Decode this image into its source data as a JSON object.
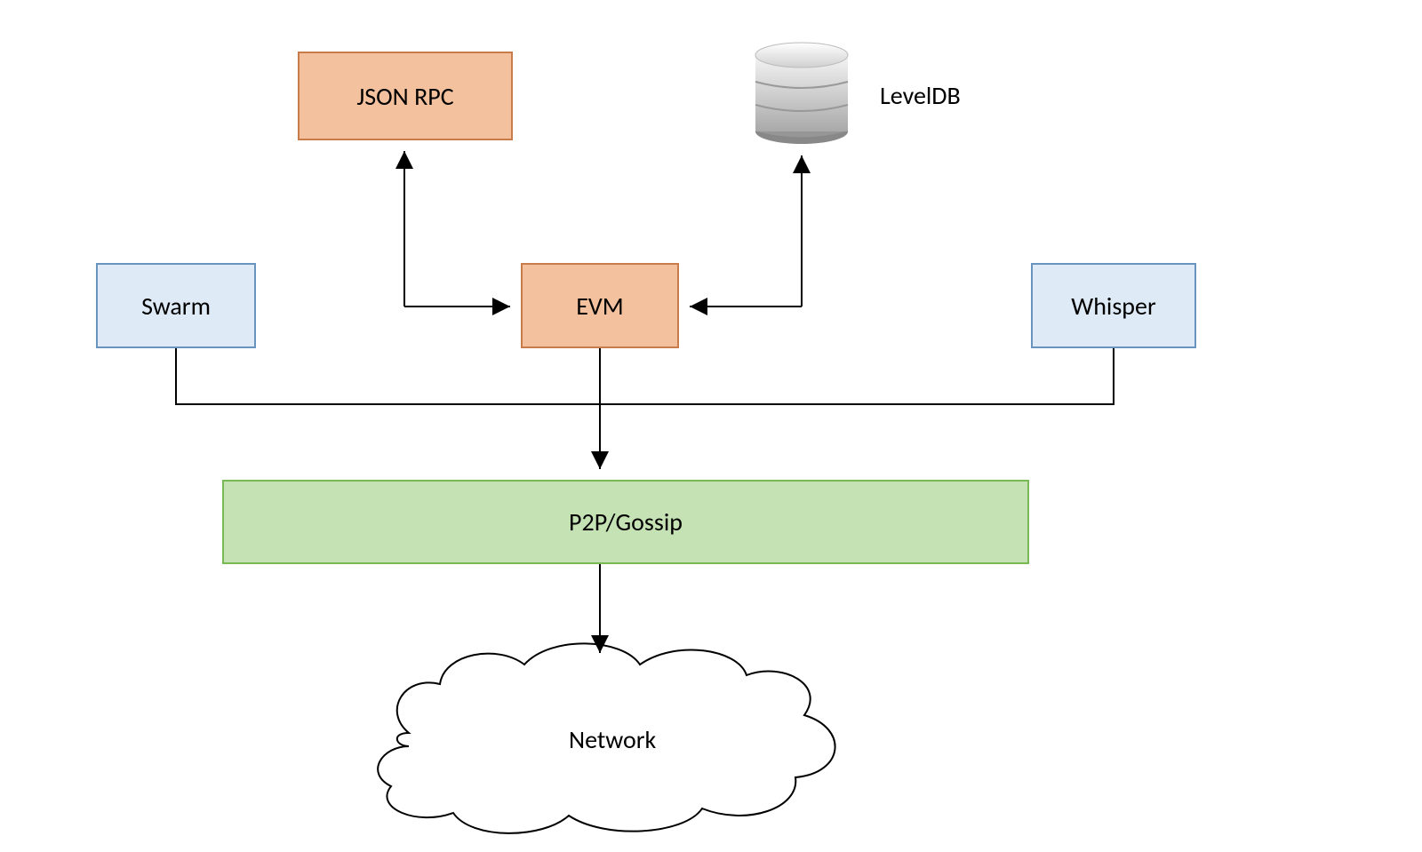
{
  "nodes": {
    "json_rpc": "JSON RPC",
    "leveldb": "LevelDB",
    "swarm": "Swarm",
    "evm": "EVM",
    "whisper": "Whisper",
    "p2p": "P2P/Gossip",
    "network": "Network"
  },
  "colors": {
    "orange_fill": "#f3c19d",
    "orange_stroke": "#c87b4b",
    "blue_fill": "#deeaf6",
    "blue_stroke": "#6a94c0",
    "green_fill": "#c4e2b3",
    "green_stroke": "#79b954"
  }
}
